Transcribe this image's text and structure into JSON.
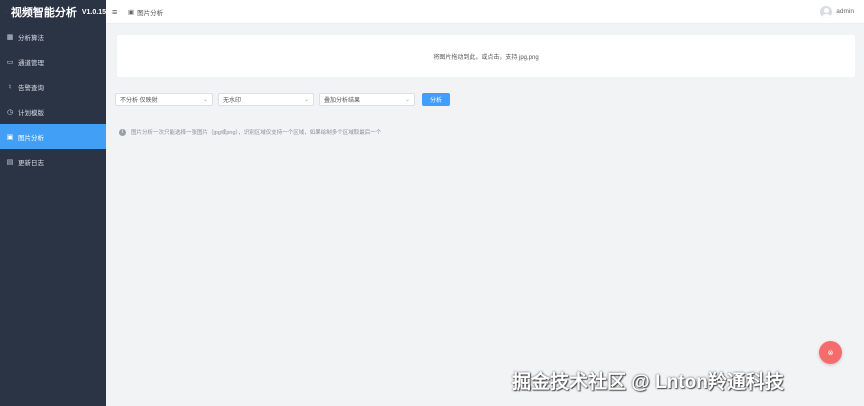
{
  "app": {
    "title": "视频智能分析",
    "version": "V1.0.15"
  },
  "sidebar": {
    "items": [
      {
        "label": "分析算法",
        "icon": "grid-icon",
        "active": false
      },
      {
        "label": "通道管理",
        "icon": "folder-icon",
        "active": false
      },
      {
        "label": "告警查询",
        "icon": "bell-icon",
        "active": false
      },
      {
        "label": "计划模版",
        "icon": "clock-icon",
        "active": false
      },
      {
        "label": "图片分析",
        "icon": "image-icon",
        "active": true
      },
      {
        "label": "更新日志",
        "icon": "document-icon",
        "active": false
      }
    ]
  },
  "header": {
    "breadcrumb": "图片分析",
    "username": "admin"
  },
  "main": {
    "upload_text": "将图片拖动到此，或点击，支持 jpg,png",
    "selects": {
      "region_mode": "不分析 仅映射",
      "watermark": "无水印",
      "overlay": "叠加分析结果"
    },
    "analyze_button": "分析",
    "info_text": "图片分析一次只能选择一张图片（jpg或png），识别区域仅支持一个区域，如果绘制多个区域取最后一个"
  },
  "fab_label": "⊗",
  "watermark_text": "掘金技术社区 @ Lnton羚通科技",
  "colors": {
    "sidebar_bg": "#2b3445",
    "accent": "#409eff",
    "active_nav": "#41a0f5",
    "fab": "#f56c6c"
  }
}
